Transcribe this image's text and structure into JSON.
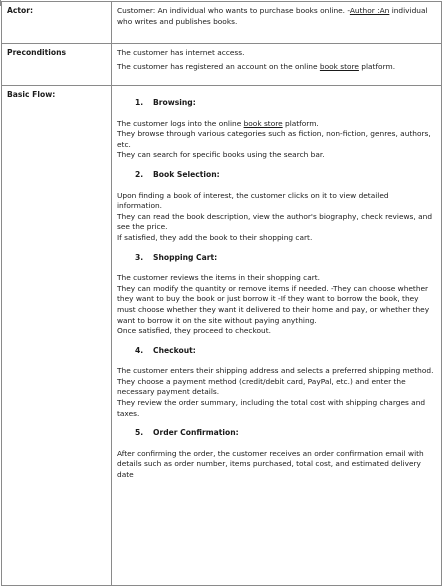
{
  "actor": {
    "label": "Actor:",
    "text_pre": "Customer: An individual who wants to purchase books online. -",
    "link": "Author :An",
    "text_post": " individual who writes and publishes books."
  },
  "preconditions": {
    "label": "Preconditions",
    "line1": "The customer has internet access.",
    "line2_pre": "The customer has registered an account on the online ",
    "line2_link": "book store",
    "line2_post": " platform."
  },
  "basic_flow": {
    "label": "Basic Flow:",
    "steps": [
      {
        "num": "1.",
        "title": "Browsing:",
        "p1_pre": "The customer logs into the online ",
        "p1_link": "book store",
        "p1_post": " platform.",
        "p2": "They browse through various categories such as fiction, non-fiction, genres, authors, etc.",
        "p3": "They can search for specific books using the search bar."
      },
      {
        "num": "2.",
        "title": "Book Selection:",
        "p1": "Upon finding a book of interest, the customer clicks on it to view detailed information.",
        "p2": "They can read the book description, view the author's biography, check reviews, and see the price.",
        "p3": "If satisfied, they add the book to their shopping cart."
      },
      {
        "num": "3.",
        "title": "Shopping Cart:",
        "p1": "The customer reviews the items in their shopping cart.",
        "p2": "They can modify the quantity or remove items if needed. -They can choose whether they want to buy the book or just borrow it -If they want to borrow the book, they must choose whether they want it delivered to their home and pay, or whether they want to borrow it on the site without paying anything.",
        "p3": "Once satisfied, they proceed to checkout."
      },
      {
        "num": "4.",
        "title": "Checkout:",
        "p1": "The customer enters their shipping address and selects a preferred shipping method.",
        "p2": "They choose a payment method (credit/debit card, PayPal, etc.) and enter the necessary payment details.",
        "p3": "They review the order summary, including the total cost with shipping charges and taxes."
      },
      {
        "num": "5.",
        "title": "Order Confirmation:",
        "p1": "After confirming the order, the customer receives an order confirmation email with details such as order number, items purchased, total cost, and estimated delivery date"
      }
    ]
  }
}
